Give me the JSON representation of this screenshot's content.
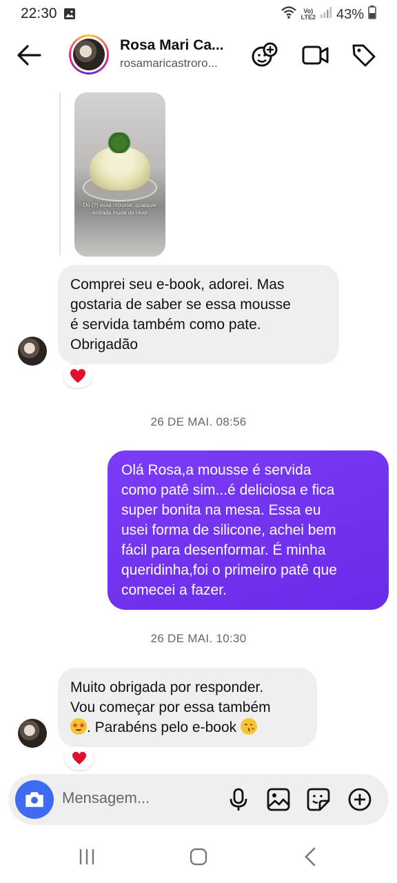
{
  "status_bar": {
    "time": "22:30",
    "battery": "43%",
    "network_label_top": "Vo)",
    "network_label_bottom": "LTE2"
  },
  "header": {
    "contact_name": "Rosa Mari Ca...",
    "contact_username": "rosamaricastroro...",
    "icons": [
      "back-arrow-icon",
      "add-people-icon",
      "video-call-icon",
      "tag-icon"
    ]
  },
  "media": {
    "caption": "Do (?) essa mousse, qualquer entrada muda de nível"
  },
  "messages": [
    {
      "direction": "incoming",
      "lines": [
        "Comprei seu e-book, adorei. Mas",
        "gostaria de saber se essa mousse",
        "é servida também como pate.",
        "Obrigadão"
      ],
      "reaction": "heart"
    },
    {
      "type": "timestamp",
      "text": "26 DE MAI. 08:56"
    },
    {
      "direction": "outgoing",
      "lines": [
        "Olá Rosa,a mousse é servida",
        "como patê sim...é deliciosa e fica",
        "super bonita na mesa. Essa eu",
        "usei forma de silicone, achei bem",
        "fácil para desenformar. É minha",
        "queridinha,foi o primeiro patê que",
        "comecei a fazer."
      ]
    },
    {
      "type": "timestamp",
      "text": "26 DE MAI. 10:30"
    },
    {
      "direction": "incoming",
      "lines": [
        "Muito obrigada por responder.",
        "Vou começar por essa também",
        ". Parabéns pelo e-book"
      ],
      "reaction": "heart"
    }
  ],
  "composer": {
    "placeholder": "Mensagem...",
    "icons": [
      "camera-icon",
      "microphone-icon",
      "gallery-icon",
      "sticker-icon",
      "plus-icon"
    ]
  },
  "colors": {
    "outgoing_bubble": "#7a3cf6",
    "incoming_bubble": "#efefef",
    "camera_button": "#3f6bf0",
    "heart": "#e0102b"
  }
}
